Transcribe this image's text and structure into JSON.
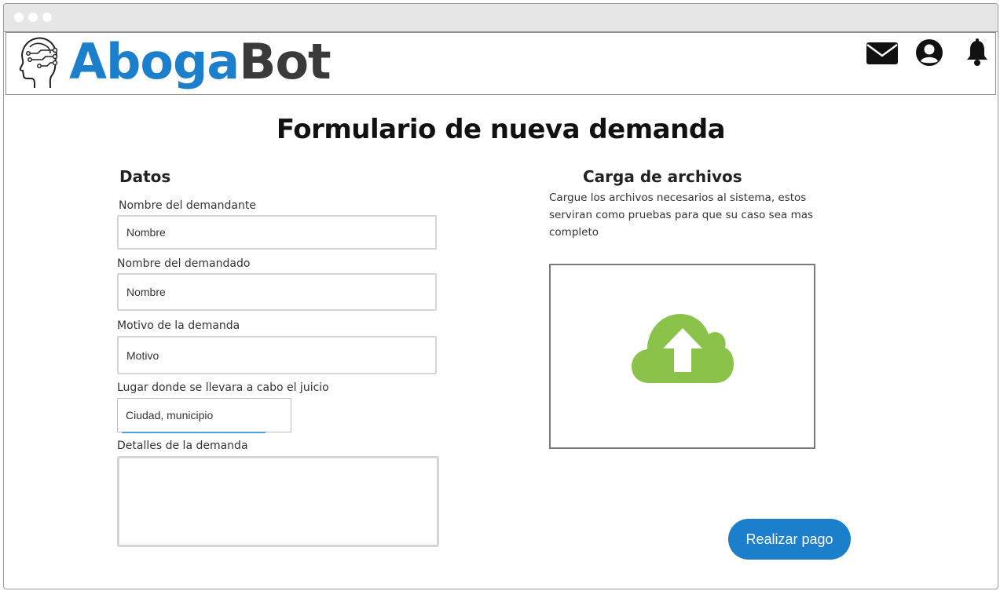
{
  "app": {
    "logo_part1": "Aboga",
    "logo_part2": "Bot",
    "brand_blue": "#1b7fcc",
    "brand_dark": "#3a3a3a"
  },
  "header_icons": [
    "mail-icon",
    "user-profile-icon",
    "bell-icon"
  ],
  "page_title": "Formulario de nueva demanda",
  "datos": {
    "title": "Datos",
    "demandante_label": "Nombre del demandante",
    "demandante_placeholder": "Nombre",
    "demandado_label": "Nombre del demandado",
    "demandado_placeholder": "Nombre",
    "motivo_label": "Motivo de la demanda",
    "motivo_placeholder": "Motivo",
    "lugar_label": "Lugar donde se llevara a cabo el juicio",
    "lugar_placeholder": "Ciudad, municipio",
    "detalles_label": "Detalles de la demanda"
  },
  "carga": {
    "title": "Carga de archivos",
    "description": "Cargue los archivos necesarios al sistema, estos serviran como pruebas para que su caso sea mas completo",
    "upload_icon": "cloud-upload-icon",
    "upload_color": "#8bc34a"
  },
  "actions": {
    "pay_label": "Realizar pago"
  }
}
